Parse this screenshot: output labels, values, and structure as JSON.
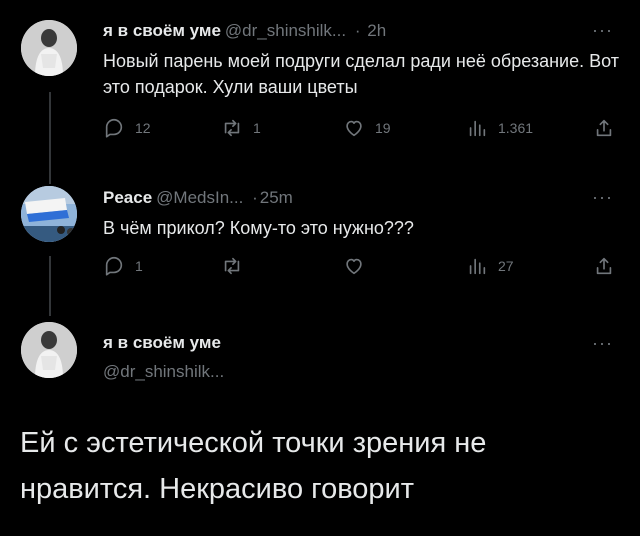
{
  "tweets": [
    {
      "name": "я в своём уме",
      "handle": "@dr_shinshilk...",
      "sep": "·",
      "time": "2h",
      "more": "···",
      "text": "Новый парень моей подруги сделал ради неё обрезание. Вот это подарок. Хули ваши цветы",
      "actions": {
        "reply": "12",
        "retweet": "1",
        "like": "19",
        "views": "1.361"
      }
    },
    {
      "name": "Peace",
      "handle": "@MedsIn...",
      "sep": "·",
      "time": "25m",
      "more": "···",
      "text": "В чём прикол? Кому-то это нужно???",
      "actions": {
        "reply": "1",
        "retweet": "",
        "like": "",
        "views": "27"
      }
    }
  ],
  "main": {
    "name": "я в своём уме",
    "handle": "@dr_shinshilk...",
    "more": "···",
    "text": "Ей с эстетической точки зрения не нравится. Некрасиво говорит"
  },
  "icons": {
    "reply": "reply-icon",
    "retweet": "retweet-icon",
    "like": "heart-icon",
    "views": "views-icon",
    "share": "share-icon"
  },
  "colors": {
    "background": "#000000",
    "text": "#e7e9ea",
    "muted": "#71767b",
    "thread": "#333639"
  }
}
